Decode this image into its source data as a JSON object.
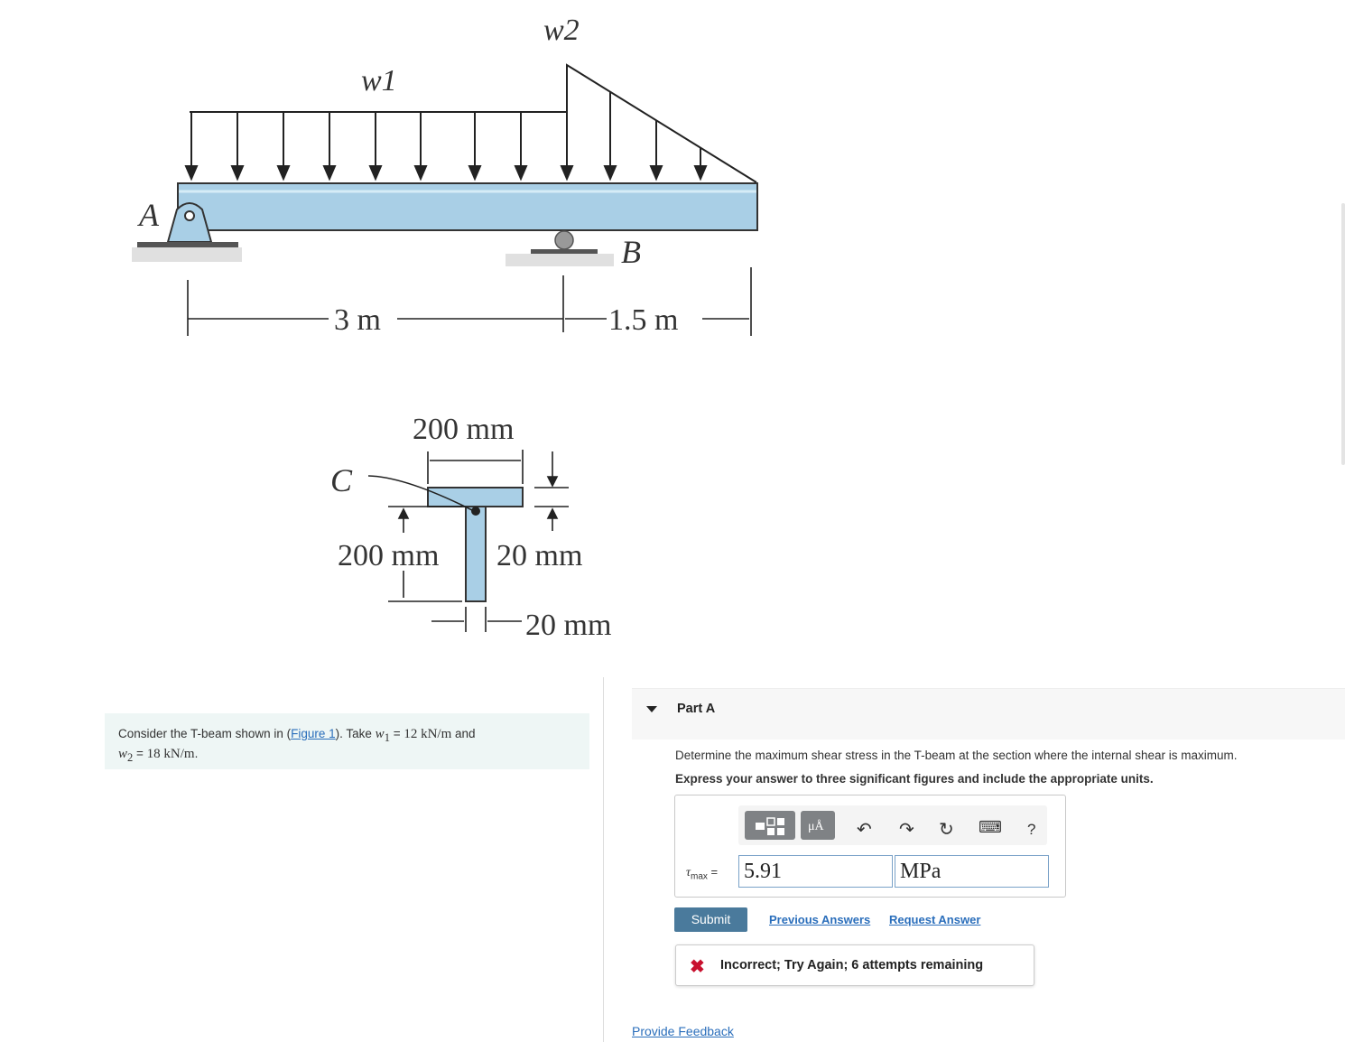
{
  "figure": {
    "load_w1": "w1",
    "load_w2": "w2",
    "support_a": "A",
    "support_b": "B",
    "span_1": "3 m",
    "span_2": "1.5 m",
    "section_top_width": "200 mm",
    "section_centroid": "C",
    "section_depth": "200 mm",
    "section_flange_thickness": "20 mm",
    "section_web_thickness": "20 mm"
  },
  "problem": {
    "prefix": "Consider the T-beam shown in (",
    "figure_link": "Figure 1",
    "mid": "). Take ",
    "w1_symbol": "w",
    "w1_sub": "1",
    "w1_value": "12 kN/m",
    "and": " and",
    "w2_symbol": "w",
    "w2_sub": "2",
    "w2_value": "18 kN/m",
    "end": "."
  },
  "part": {
    "title": "Part A",
    "question": "Determine the maximum shear stress in the T-beam at the section where the internal shear is maximum.",
    "instruction": "Express your answer to three significant figures and include the appropriate units."
  },
  "toolbar": {
    "undo_icon": "↶",
    "redo_icon": "↷",
    "reset_icon": "↻",
    "keyboard_icon": "⌨",
    "help_label": "?",
    "units_label": "μÅ"
  },
  "answer": {
    "symbol": "τ",
    "sub": "max",
    "equals": " =",
    "value": "5.91",
    "units": "MPa"
  },
  "actions": {
    "submit": "Submit",
    "previous_answers": "Previous Answers",
    "request_answer": "Request Answer"
  },
  "feedback": {
    "icon": "✖",
    "message": "Incorrect; Try Again; 6 attempts remaining"
  },
  "footer": {
    "provide_feedback": "Provide Feedback"
  },
  "colors": {
    "beam_fill": "#a9cfe6",
    "link": "#2a6ebb",
    "submit_bg": "#4a7a9c",
    "error": "#c8102e"
  }
}
